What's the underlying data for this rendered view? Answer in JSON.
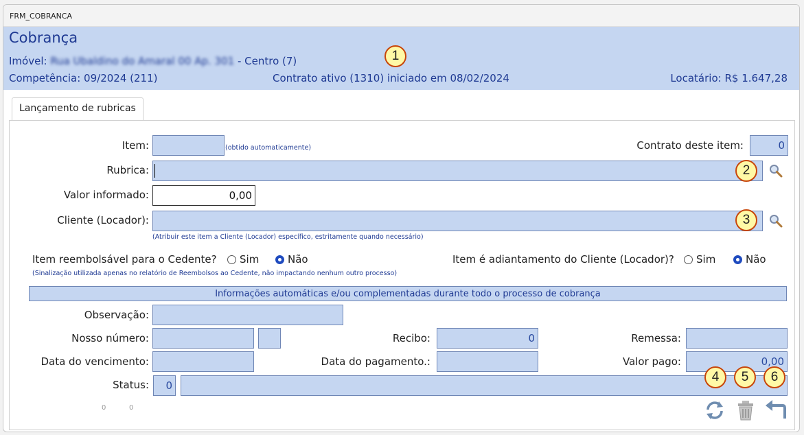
{
  "window": {
    "title": "FRM_COBRANCA"
  },
  "header": {
    "title": "Cobrança",
    "imovel_label": "Imóvel:",
    "imovel_value": "Rua Ubaldino do Amaral 00 Ap. 301",
    "imovel_suffix": " - Centro (7)",
    "competencia": "Competência: 09/2024 (211)",
    "contrato": "Contrato ativo (1310) iniciado em 08/02/2024",
    "locatario": "Locatário: R$ 1.647,28"
  },
  "callouts": [
    "1",
    "2",
    "3",
    "4",
    "5",
    "6"
  ],
  "tabs": [
    {
      "label": "Lançamento de rubricas"
    }
  ],
  "form": {
    "item_label": "Item:",
    "item_value": "",
    "item_hint": "(obtido automaticamente)",
    "contrato_item_label": "Contrato deste item:",
    "contrato_item_value": "0",
    "rubrica_label": "Rubrica:",
    "rubrica_value": "",
    "valor_label": "Valor informado:",
    "valor_value": "0,00",
    "cliente_label": "Cliente (Locador):",
    "cliente_value": "",
    "cliente_hint": "(Atribuir este item a Cliente (Locador) específico, estritamente quando necessário)",
    "reembolsavel_label": "Item reembolsável para o Cedente?",
    "reembolsavel_options": [
      "Sim",
      "Não"
    ],
    "reembolsavel_selected": "Não",
    "reembolsavel_hint": "(Sinalização utilizada apenas no relatório de Reembolsos ao Cedente, não impactando nenhum outro processo)",
    "adiantamento_label": "Item é adiantamento do Cliente (Locador)?",
    "adiantamento_options": [
      "Sim",
      "Não"
    ],
    "adiantamento_selected": "Não"
  },
  "auto_section": {
    "title": "Informações automáticas e/ou complementadas durante todo o processo de cobrança",
    "observacao_label": "Observação:",
    "observacao_value": "",
    "nosso_numero_label": "Nosso número:",
    "nosso_numero_value": "",
    "nosso_numero_dv": "",
    "recibo_label": "Recibo:",
    "recibo_value": "0",
    "remessa_label": "Remessa:",
    "remessa_value": "",
    "vencimento_label": "Data do vencimento:",
    "vencimento_value": "",
    "pagamento_label": "Data do pagamento.:",
    "pagamento_value": "",
    "valor_pago_label": "Valor pago:",
    "valor_pago_value": "0,00",
    "status_label": "Status:",
    "status_code": "0",
    "status_text": ""
  },
  "footer": {
    "counter_a": "0",
    "counter_b": "0",
    "actions": [
      {
        "name": "refresh",
        "icon": "refresh-icon"
      },
      {
        "name": "delete",
        "icon": "trash-icon"
      },
      {
        "name": "back",
        "icon": "undo-arrow-icon"
      }
    ]
  },
  "colors": {
    "header_bg": "#c5d6f1",
    "accent_text": "#1f3a93",
    "field_bg": "#c5d6f1",
    "callout_fill": "#fff9a6",
    "callout_border": "#c8460a"
  }
}
